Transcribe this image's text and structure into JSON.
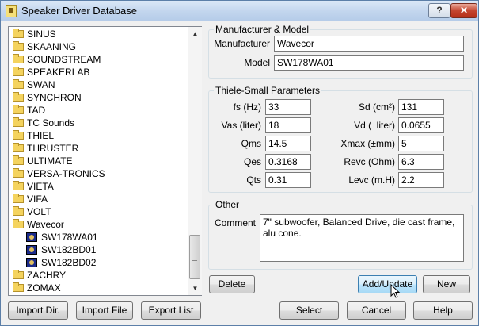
{
  "window": {
    "title": "Speaker Driver Database",
    "help_button": "?",
    "close_button": "✕"
  },
  "tree": {
    "items": [
      {
        "label": "SINUS",
        "type": "folder"
      },
      {
        "label": "SKAANING",
        "type": "folder"
      },
      {
        "label": "SOUNDSTREAM",
        "type": "folder"
      },
      {
        "label": "SPEAKERLAB",
        "type": "folder"
      },
      {
        "label": "SWAN",
        "type": "folder"
      },
      {
        "label": "SYNCHRON",
        "type": "folder"
      },
      {
        "label": "TAD",
        "type": "folder"
      },
      {
        "label": "TC Sounds",
        "type": "folder"
      },
      {
        "label": "THIEL",
        "type": "folder"
      },
      {
        "label": "THRUSTER",
        "type": "folder"
      },
      {
        "label": "ULTIMATE",
        "type": "folder"
      },
      {
        "label": "VERSA-TRONICS",
        "type": "folder"
      },
      {
        "label": "VIETA",
        "type": "folder"
      },
      {
        "label": "VIFA",
        "type": "folder"
      },
      {
        "label": "VOLT",
        "type": "folder"
      },
      {
        "label": "Wavecor",
        "type": "folder"
      },
      {
        "label": "SW178WA01",
        "type": "driver"
      },
      {
        "label": "SW182BD01",
        "type": "driver"
      },
      {
        "label": "SW182BD02",
        "type": "driver"
      },
      {
        "label": "ZACHRY",
        "type": "folder"
      },
      {
        "label": "ZOMAX",
        "type": "folder"
      }
    ]
  },
  "manufacturer_model": {
    "group_title": "Manufacturer & Model",
    "manufacturer_label": "Manufacturer",
    "manufacturer_value": "Wavecor",
    "model_label": "Model",
    "model_value": "SW178WA01"
  },
  "thiele_small": {
    "group_title": "Thiele-Small Parameters",
    "left": [
      {
        "label": "fs (Hz)",
        "value": "33"
      },
      {
        "label": "Vas (liter)",
        "value": "18"
      },
      {
        "label": "Qms",
        "value": "14.5"
      },
      {
        "label": "Qes",
        "value": "0.3168"
      },
      {
        "label": "Qts",
        "value": "0.31"
      }
    ],
    "right": [
      {
        "label": "Sd (cm²)",
        "value": "131"
      },
      {
        "label": "Vd (±liter)",
        "value": "0.0655"
      },
      {
        "label": "Xmax (±mm)",
        "value": "5"
      },
      {
        "label": "Revc (Ohm)",
        "value": "6.3"
      },
      {
        "label": "Levc (m.H)",
        "value": "2.2"
      }
    ]
  },
  "other": {
    "group_title": "Other",
    "comment_label": "Comment",
    "comment_value": "7\" subwoofer, Balanced Drive, die cast frame, alu cone."
  },
  "buttons": {
    "delete": "Delete",
    "add_update": "Add/Update",
    "new": "New",
    "import_dir": "Import Dir.",
    "import_file": "Import File",
    "export_list": "Export List",
    "select": "Select",
    "cancel": "Cancel",
    "help": "Help"
  }
}
